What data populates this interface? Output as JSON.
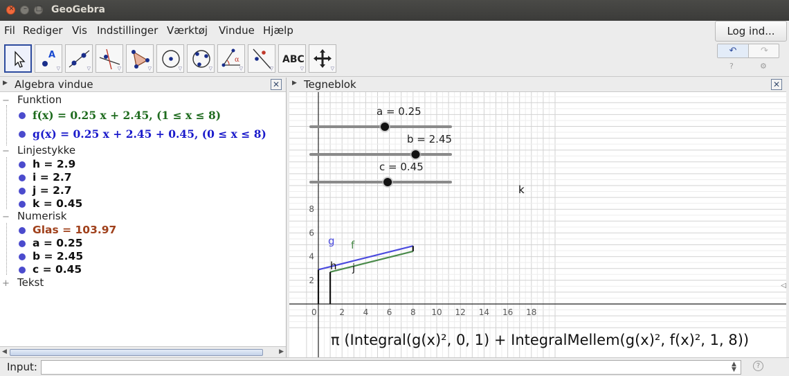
{
  "window": {
    "title": "GeoGebra"
  },
  "menu": {
    "items": [
      "Fil",
      "Rediger",
      "Vis",
      "Indstillinger",
      "Værktøj",
      "Vindue",
      "Hjælp"
    ],
    "login_label": "Log ind..."
  },
  "toolbar": {
    "tools": [
      {
        "name": "move-tool-icon"
      },
      {
        "name": "point-tool-icon"
      },
      {
        "name": "line-tool-icon"
      },
      {
        "name": "perpendicular-line-tool-icon"
      },
      {
        "name": "polygon-tool-icon"
      },
      {
        "name": "circle-tool-icon"
      },
      {
        "name": "circle-three-points-tool-icon"
      },
      {
        "name": "angle-tool-icon"
      },
      {
        "name": "reflect-tool-icon"
      },
      {
        "name": "text-tool-icon",
        "label": "ABC"
      },
      {
        "name": "move-graphics-view-tool-icon"
      }
    ],
    "undo_icon": "↶",
    "redo_icon": "↷",
    "help_icon": "?",
    "settings_icon": "⚙"
  },
  "algebra": {
    "title": "Algebra vindue",
    "categories": {
      "funktion": "Funktion",
      "linjestykke": "Linjestykke",
      "numerisk": "Numerisk",
      "tekst": "Tekst"
    },
    "functions": [
      {
        "text": "f(x)  =  0.25 x + 2.45,     (1 ≤ x ≤ 8)",
        "color": "#1e6b1e"
      },
      {
        "text": "g(x)  =  0.25 x + 2.45 + 0.45,     (0 ≤ x ≤ 8)",
        "color": "#1a1acb"
      }
    ],
    "segments": [
      "h = 2.9",
      "i = 2.7",
      "j = 2.7",
      "k = 0.45"
    ],
    "numerics": [
      {
        "text": "Glas = 103.97",
        "color": "#a0411c"
      },
      {
        "text": "a = 0.25",
        "color": "#111111"
      },
      {
        "text": "b = 2.45",
        "color": "#111111"
      },
      {
        "text": "c = 0.45",
        "color": "#111111"
      }
    ]
  },
  "graphics": {
    "title": "Tegneblok",
    "sliders": [
      {
        "label": "a = 0.25",
        "value": 0.25
      },
      {
        "label": "b = 2.45",
        "value": 2.45
      },
      {
        "label": "c = 0.45",
        "value": 0.45
      }
    ],
    "x_ticks": [
      "0",
      "2",
      "4",
      "6",
      "8",
      "10",
      "12",
      "14",
      "16",
      "18"
    ],
    "y_ticks": [
      "2",
      "4",
      "6",
      "8"
    ],
    "object_labels": {
      "g": "g",
      "f": "f",
      "h": "h",
      "j": "j",
      "k": "k"
    },
    "formula": "π (Integral(g(x)², 0, 1) + IntegralMellem(g(x)², f(x)², 1, 8))",
    "colors": {
      "g": "#4b4bde",
      "f": "#4a8a4a",
      "segment": "#111111"
    }
  },
  "input": {
    "label": "Input:",
    "value": "",
    "help_icon": "?"
  }
}
